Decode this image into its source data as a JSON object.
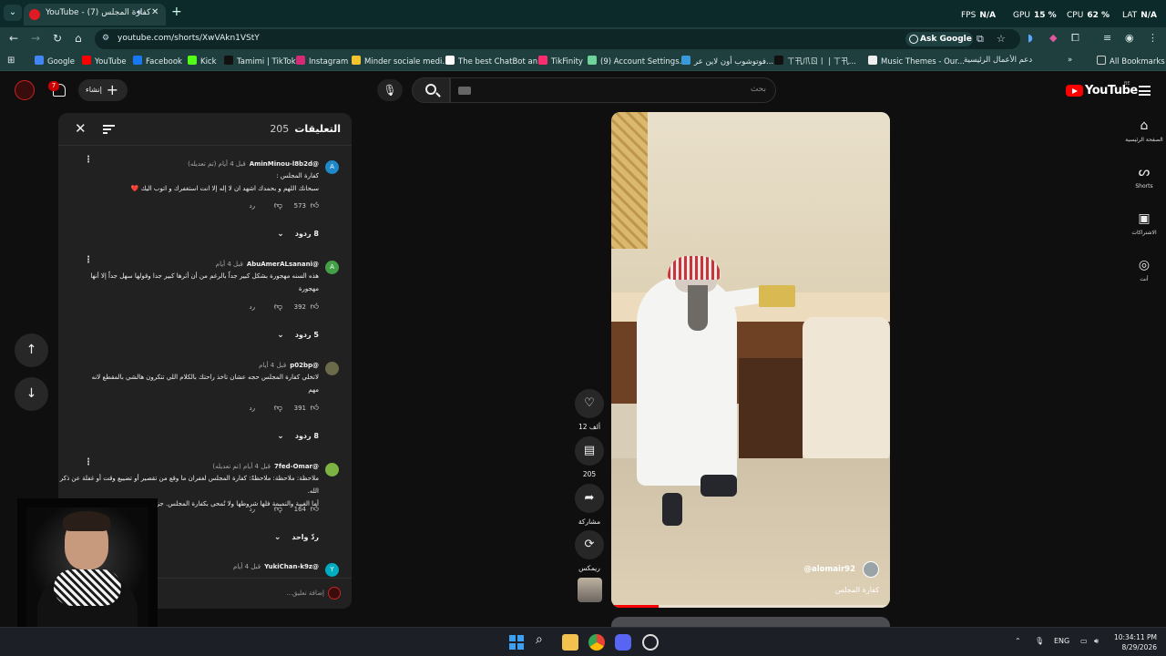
{
  "browser": {
    "tab": {
      "title": "YouTube - (7) كفارة المجلس"
    },
    "stats": [
      {
        "label": "FPS",
        "value": "N/A"
      },
      {
        "label": "GPU",
        "value": "15 %"
      },
      {
        "label": "CPU",
        "value": "62 %"
      },
      {
        "label": "LAT",
        "value": "N/A"
      }
    ],
    "url": "youtube.com/shorts/XwVAkn1VStY",
    "ask_google": "Ask Google",
    "bookmarks": [
      {
        "label": "Google",
        "color": "#4285f4"
      },
      {
        "label": "YouTube",
        "color": "#ff0000"
      },
      {
        "label": "Facebook",
        "color": "#1877f2"
      },
      {
        "label": "Kick",
        "color": "#53fc18"
      },
      {
        "label": "Tamimi | TikTok",
        "color": "#111111"
      },
      {
        "label": "Instagram",
        "color": "#d62976"
      },
      {
        "label": "Minder sociale medi...",
        "color": "#f4c430"
      },
      {
        "label": "The best ChatBot an...",
        "color": "#ffffff"
      },
      {
        "label": "TikFinity",
        "color": "#ff2d6f"
      },
      {
        "label": "(9) Account Settings...",
        "color": "#6dd39a"
      },
      {
        "label": "فوتوشوب أون لاين عر...",
        "color": "#3a9ad9"
      },
      {
        "label": "ㄒ卂爪ㄖ丨 | ㄒ卂...",
        "color": "#111111"
      },
      {
        "label": "Music Themes - Our...",
        "color": "#eeeeee"
      },
      {
        "label": "دعم الأعمال الرئيسية",
        "color": "#888888"
      }
    ],
    "all_bookmarks": "All Bookmarks"
  },
  "youtube": {
    "notifications": "7",
    "create_label": "إنشاء",
    "search_placeholder": "بحث",
    "logo_text": "YouTube",
    "country_code": "BE",
    "guide": [
      {
        "label": "الصفحة الرئيسية",
        "icon": "home-icon"
      },
      {
        "label": "Shorts",
        "icon": "shorts-icon"
      },
      {
        "label": "الاشتراكات",
        "icon": "subscriptions-icon"
      },
      {
        "label": "أنت",
        "icon": "you-icon"
      }
    ]
  },
  "comments_panel": {
    "title": "التعليقات",
    "count": "205",
    "comments": [
      {
        "user": "@AminMinou-l8b2d",
        "meta": "قبل 4 أيام (تم تعديله)",
        "avatar_letter": "A",
        "avatar_color": "#1e88c9",
        "lines": [
          "كفارة المجلس :",
          "سبحانك اللهم و بحمدك اشهد ان لا إله إلا انت استغفرك و اتوب اليك ❤️"
        ],
        "likes": "573",
        "reply": "رد",
        "replies": "8 ردود"
      },
      {
        "user": "@AbuAmerALsanani",
        "meta": "قبل 4 أيام",
        "avatar_letter": "A",
        "avatar_color": "#43a047",
        "lines": [
          "هذه السنه مهجورة بشكل كبير جداً بالرغم من أن أثرها كبير جدا وقولها سهل جداً إلا أنها",
          "مهجورة"
        ],
        "likes": "392",
        "reply": "رد",
        "replies": "5 ردود"
      },
      {
        "user": "@p02bp",
        "meta": "قبل 4 أيام",
        "avatar_letter": "",
        "avatar_color": "#6b6a4a",
        "lines": [
          "لاتخلي كفارة المجلس حجه عشان تاخذ راحتك بالكلام اللي تتكرون هالشي بالمقطع لانه",
          "مهم"
        ],
        "likes": "391",
        "reply": "رد",
        "replies": "8 ردود"
      },
      {
        "user": "@7fed-Omar",
        "meta": "قبل 4 أيام (تم تعديله)",
        "avatar_letter": "",
        "avatar_color": "#7cb342",
        "lines": [
          "ملاحظة: ملاحظة: ملاحظةً: كفارة المجلس لغفران ما وقع من تقصير أو تضييع وقت أو غفلة عن ذكر الله.",
          "أما الغيبة والنميمة فلها شروطها ولا تُمحى بكفارة المجلس. جزاك الله خيراً."
        ],
        "likes": "164",
        "reply": "رد",
        "replies": "ردّ واحد"
      },
      {
        "user": "@YukiChan-k9z",
        "meta": "قبل 4 أيام",
        "avatar_letter": "Y",
        "avatar_color": "#00acc1",
        "lines": [],
        "likes": "",
        "reply": "",
        "replies": ""
      }
    ],
    "add_comment_placeholder": "إضافة تعليق..."
  },
  "video": {
    "channel": "@alomair92",
    "title": "كفارة المجلس",
    "progress": 0.17
  },
  "actions": [
    {
      "name": "like-button",
      "icon": "heart-icon",
      "label": "12 ألف"
    },
    {
      "name": "comments-button",
      "icon": "comment-icon",
      "label": "205"
    },
    {
      "name": "share-button",
      "icon": "share-icon",
      "label": "مشاركة"
    },
    {
      "name": "remix-button",
      "icon": "remix-icon",
      "label": "ريمكس"
    }
  ],
  "taskbar": {
    "language": "ENG",
    "time": "10:34:11 PM",
    "date": "8/29/2026"
  }
}
